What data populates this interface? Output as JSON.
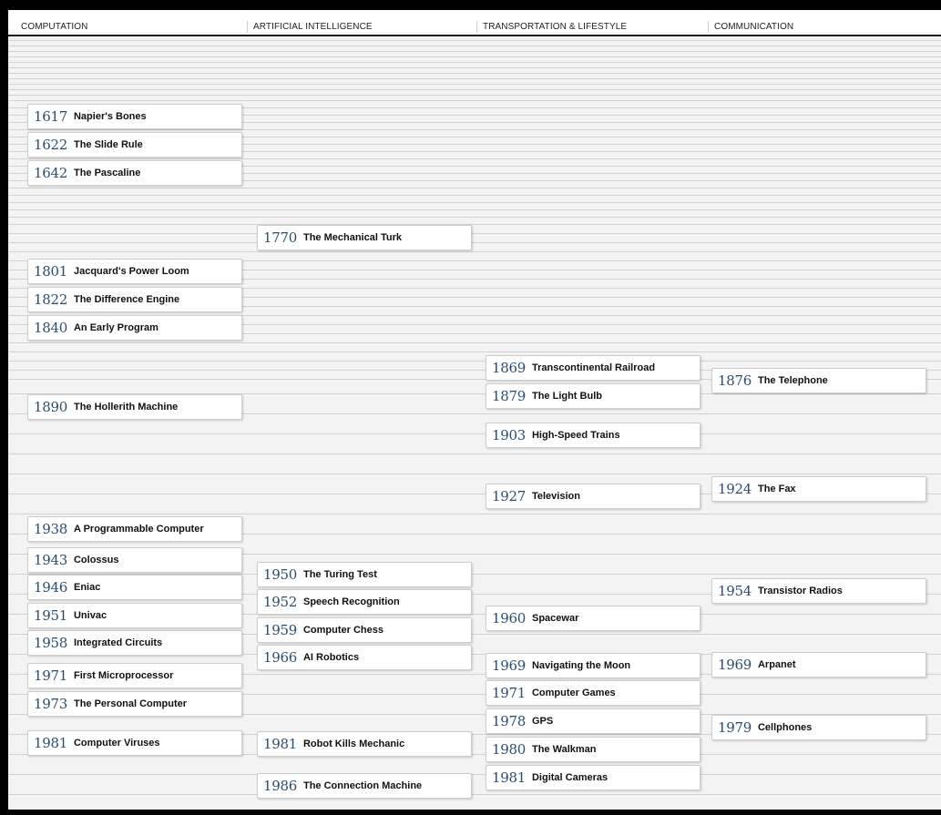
{
  "columns": [
    {
      "id": "computation",
      "label": "COMPUTATION"
    },
    {
      "id": "ai",
      "label": "ARTIFICIAL INTELLIGENCE"
    },
    {
      "id": "transport",
      "label": "TRANSPORTATION & LIFESTYLE"
    },
    {
      "id": "communication",
      "label": "COMMUNICATION"
    }
  ],
  "events": [
    {
      "col": 0,
      "year": "1617",
      "title": "Napier's Bones"
    },
    {
      "col": 0,
      "year": "1622",
      "title": "The Slide Rule"
    },
    {
      "col": 0,
      "year": "1642",
      "title": "The Pascaline"
    },
    {
      "col": 1,
      "year": "1770",
      "title": "The Mechanical Turk"
    },
    {
      "col": 0,
      "year": "1801",
      "title": "Jacquard's Power Loom"
    },
    {
      "col": 0,
      "year": "1822",
      "title": "The Difference Engine"
    },
    {
      "col": 0,
      "year": "1840",
      "title": "An Early Program"
    },
    {
      "col": 2,
      "year": "1869",
      "title": "Transcontinental Railroad"
    },
    {
      "col": 3,
      "year": "1876",
      "title": "The Telephone"
    },
    {
      "col": 2,
      "year": "1879",
      "title": "The Light Bulb"
    },
    {
      "col": 0,
      "year": "1890",
      "title": "The Hollerith Machine"
    },
    {
      "col": 2,
      "year": "1903",
      "title": "High-Speed Trains"
    },
    {
      "col": 3,
      "year": "1924",
      "title": "The Fax"
    },
    {
      "col": 2,
      "year": "1927",
      "title": "Television"
    },
    {
      "col": 0,
      "year": "1938",
      "title": "A Programmable Computer"
    },
    {
      "col": 0,
      "year": "1943",
      "title": "Colossus"
    },
    {
      "col": 0,
      "year": "1946",
      "title": "Eniac"
    },
    {
      "col": 1,
      "year": "1950",
      "title": "The Turing Test"
    },
    {
      "col": 0,
      "year": "1951",
      "title": "Univac"
    },
    {
      "col": 1,
      "year": "1952",
      "title": "Speech Recognition"
    },
    {
      "col": 3,
      "year": "1954",
      "title": "Transistor Radios"
    },
    {
      "col": 0,
      "year": "1958",
      "title": "Integrated Circuits"
    },
    {
      "col": 1,
      "year": "1959",
      "title": "Computer Chess"
    },
    {
      "col": 2,
      "year": "1960",
      "title": "Spacewar"
    },
    {
      "col": 1,
      "year": "1966",
      "title": "AI Robotics"
    },
    {
      "col": 2,
      "year": "1969",
      "title": "Navigating the Moon"
    },
    {
      "col": 3,
      "year": "1969",
      "title": "Arpanet"
    },
    {
      "col": 0,
      "year": "1971",
      "title": "First Microprocessor"
    },
    {
      "col": 2,
      "year": "1971",
      "title": "Computer Games"
    },
    {
      "col": 0,
      "year": "1973",
      "title": "The Personal Computer"
    },
    {
      "col": 2,
      "year": "1978",
      "title": "GPS"
    },
    {
      "col": 3,
      "year": "1979",
      "title": "Cellphones"
    },
    {
      "col": 2,
      "year": "1980",
      "title": "The Walkman"
    },
    {
      "col": 0,
      "year": "1981",
      "title": "Computer Viruses"
    },
    {
      "col": 1,
      "year": "1981",
      "title": "Robot Kills Mechanic"
    },
    {
      "col": 2,
      "year": "1981",
      "title": "Digital Cameras"
    },
    {
      "col": 1,
      "year": "1986",
      "title": "The Connection Machine"
    }
  ]
}
